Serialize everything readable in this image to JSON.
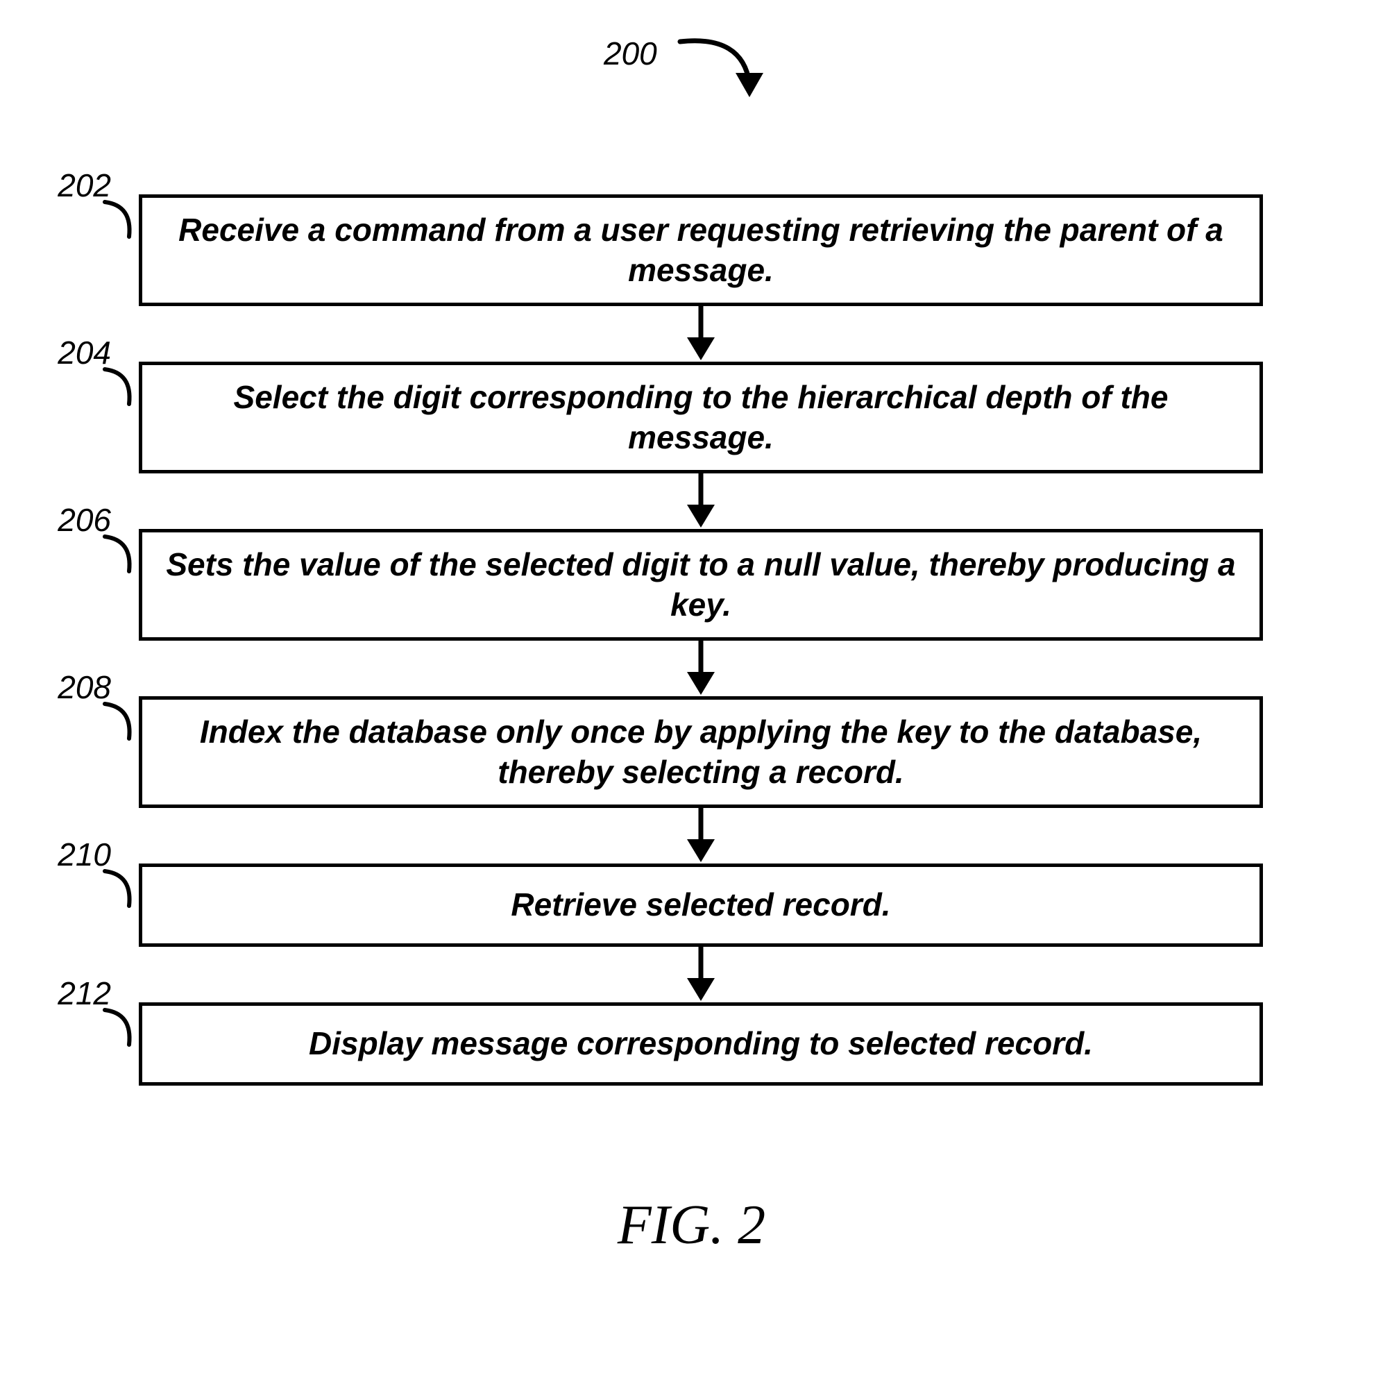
{
  "diagram": {
    "ref": "200",
    "figure_label": "FIG. 2",
    "steps": [
      {
        "num": "202",
        "text": "Receive a command from a user requesting retrieving the parent of a message."
      },
      {
        "num": "204",
        "text": "Select the digit corresponding to the hierarchical depth of the message."
      },
      {
        "num": "206",
        "text": "Sets the value of the selected digit to a null value, thereby producing a key."
      },
      {
        "num": "208",
        "text": "Index the database only once by applying the key to the database, thereby selecting a record."
      },
      {
        "num": "210",
        "text": "Retrieve selected record."
      },
      {
        "num": "212",
        "text": "Display message corresponding to selected record."
      }
    ]
  }
}
